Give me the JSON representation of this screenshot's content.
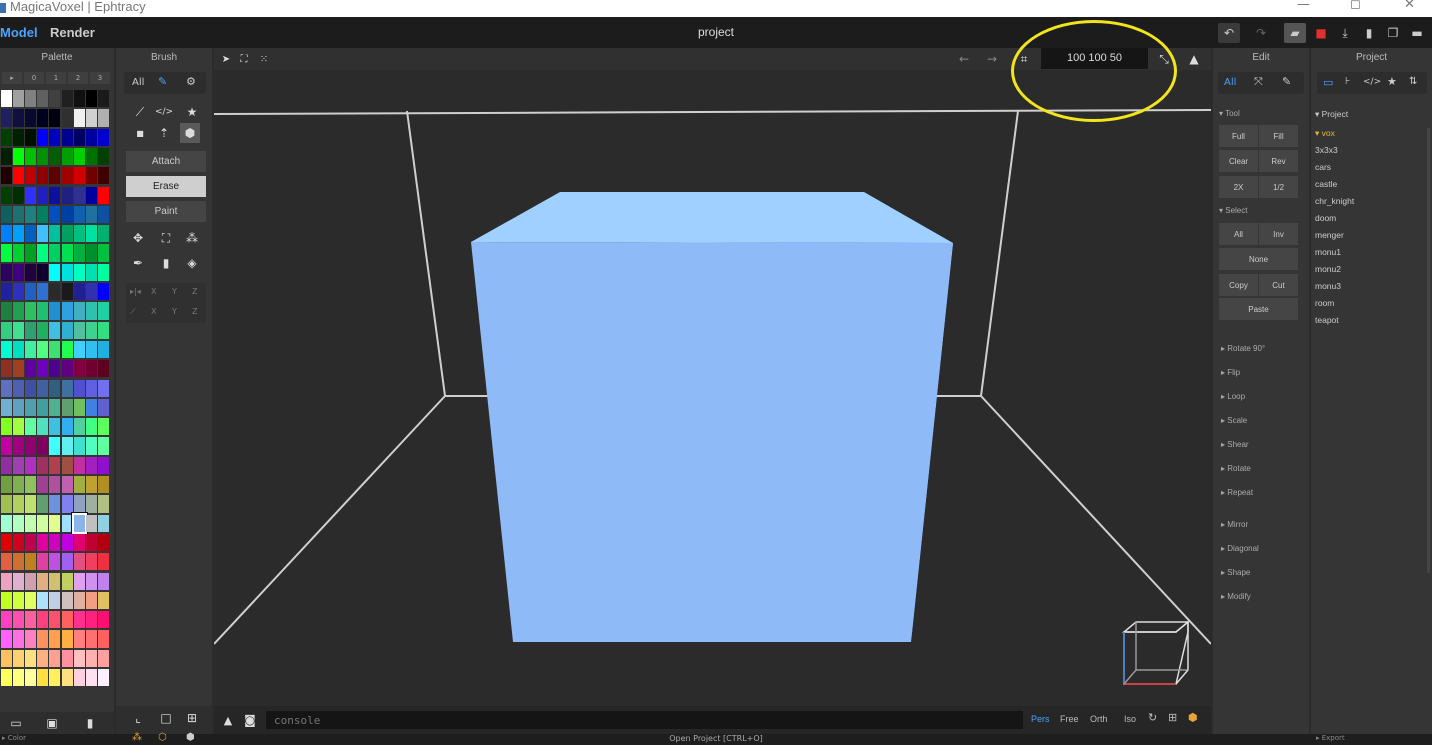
{
  "window": {
    "title": "MagicaVoxel | Ephtracy",
    "min": "—",
    "max": "◻",
    "close": "✕"
  },
  "menu": {
    "model": "Model",
    "render": "Render",
    "project_title": "project"
  },
  "palette": {
    "title": "Palette",
    "tabs": [
      "▸",
      "0",
      "1",
      "2",
      "3"
    ],
    "selected_color": "#8cb4e8",
    "colors": [
      [
        "#ffffff",
        "#a0a0a0",
        "#808080",
        "#606060",
        "#404040",
        "#202020",
        "#101010",
        "#000000",
        "#1a1a1a"
      ],
      [
        "#202060",
        "#101040",
        "#080830",
        "#000020",
        "#000010",
        "#303030",
        "#f0f0f0",
        "#d0d0d0",
        "#b0b0b0"
      ],
      [
        "#004000",
        "#002000",
        "#001000",
        "#0000ff",
        "#0000c0",
        "#000090",
        "#000060",
        "#0000a0",
        "#0000d0"
      ],
      [
        "#002000",
        "#00ff00",
        "#00c000",
        "#009000",
        "#006000",
        "#00a000",
        "#00d000",
        "#007000",
        "#004000"
      ],
      [
        "#200000",
        "#ff0000",
        "#c00000",
        "#900000",
        "#600000",
        "#a00000",
        "#d00000",
        "#700000",
        "#400000"
      ],
      [
        "#004000",
        "#003000",
        "#3030ff",
        "#2020c0",
        "#1010a0",
        "#202080",
        "#303090",
        "#0000a0",
        "#ff0000"
      ],
      [
        "#106060",
        "#207070",
        "#208080",
        "#008060",
        "#0050c0",
        "#0040a0",
        "#1060b0",
        "#2070a0",
        "#1050a0"
      ],
      [
        "#0080ff",
        "#00a0ff",
        "#0060c0",
        "#40c0ff",
        "#00c0a0",
        "#00a060",
        "#00c080",
        "#00e0a0",
        "#00b070"
      ],
      [
        "#00ff40",
        "#00d030",
        "#00a020",
        "#00ff80",
        "#00d060",
        "#00e050",
        "#00b040",
        "#009030",
        "#00c040"
      ],
      [
        "#300060",
        "#400080",
        "#200040",
        "#100030",
        "#00ffff",
        "#00e0e0",
        "#00ffc0",
        "#00e0b0",
        "#00ffa0"
      ],
      [
        "#2020a0",
        "#3030c0",
        "#2060c0",
        "#3070d0",
        "#2a2a2a",
        "#1a1a1a",
        "#202090",
        "#3030b0",
        "#0000ff"
      ],
      [
        "#208040",
        "#20a050",
        "#30c060",
        "#20c070",
        "#2090d0",
        "#30a0e0",
        "#40b0c0",
        "#30c0b0",
        "#20d0a0"
      ],
      [
        "#30d080",
        "#40e090",
        "#30a070",
        "#20b060",
        "#40c0e0",
        "#30b0d0",
        "#50c0a0",
        "#40d090",
        "#30e080"
      ],
      [
        "#00ffd0",
        "#00e0c0",
        "#40f0a0",
        "#50ff80",
        "#40e070",
        "#20ff50",
        "#40d0ff",
        "#30c0f0",
        "#20b0e0"
      ],
      [
        "#903020",
        "#a04020",
        "#6000a0",
        "#7000c0",
        "#500090",
        "#600080",
        "#800040",
        "#700030",
        "#600020"
      ],
      [
        "#6070c0",
        "#5060b0",
        "#4050a0",
        "#4060a0",
        "#306080",
        "#4070a0",
        "#5050d0",
        "#6060e0",
        "#7070f0"
      ],
      [
        "#70b0d0",
        "#60a0c0",
        "#50a0b0",
        "#40a0a0",
        "#50b090",
        "#60a070",
        "#70c060",
        "#4080e0",
        "#6060d0"
      ],
      [
        "#80ff20",
        "#a0ff40",
        "#60ffa0",
        "#50e0c0",
        "#40c0e0",
        "#30b0f0",
        "#50d0a0",
        "#40ff80",
        "#60ff60"
      ],
      [
        "#c000a0",
        "#a00080",
        "#900070",
        "#800060",
        "#40ffff",
        "#60f0f0",
        "#40e0d0",
        "#50ffc0",
        "#60ffa0"
      ],
      [
        "#9030a0",
        "#a040b0",
        "#b030c0",
        "#a03060",
        "#b04050",
        "#a05040",
        "#c030a0",
        "#a020c0",
        "#9010d0"
      ],
      [
        "#70a040",
        "#80b050",
        "#90c060",
        "#a04090",
        "#b050a0",
        "#c060b0",
        "#a0b040",
        "#c0a030",
        "#b09020"
      ],
      [
        "#a0c050",
        "#b0d060",
        "#c0e070",
        "#60a070",
        "#7090e0",
        "#8080f0",
        "#90a0c0",
        "#a0b0a0",
        "#b0c080"
      ],
      [
        "#a0ffd0",
        "#b0ffc0",
        "#c0ffb0",
        "#d0ffa0",
        "#e0ff90",
        "#a0e0ff",
        "#8cb4e8",
        "#c0c0c0",
        "#90d0e0"
      ],
      [
        "#e00000",
        "#d00020",
        "#c00050",
        "#e000a0",
        "#d000c0",
        "#c000e0",
        "#e00070",
        "#c00030",
        "#b00010"
      ],
      [
        "#e06040",
        "#d07030",
        "#c08020",
        "#e040a0",
        "#c050e0",
        "#a060f0",
        "#e05080",
        "#f04060",
        "#f03040"
      ],
      [
        "#f0a0c0",
        "#e0b0d0",
        "#d0a0b0",
        "#e0b080",
        "#d0c070",
        "#c0d060",
        "#e0a0f0",
        "#d090f0",
        "#c080f0"
      ],
      [
        "#c0ff20",
        "#d0ff40",
        "#e0ff60",
        "#b0e0ff",
        "#c0d0e0",
        "#d0c0c0",
        "#e0b0a0",
        "#f0a080",
        "#e0c060"
      ],
      [
        "#ff40c0",
        "#ff50b0",
        "#ff60a0",
        "#ff4080",
        "#ff5070",
        "#ff6060",
        "#ff3090",
        "#ff2080",
        "#ff1070"
      ],
      [
        "#ff60ff",
        "#ff70e0",
        "#ff80c0",
        "#ff9060",
        "#ffa050",
        "#ffb040",
        "#ff8080",
        "#ff7070",
        "#ff6060"
      ],
      [
        "#ffc060",
        "#ffd070",
        "#ffe080",
        "#ffb080",
        "#ffa090",
        "#ff90a0",
        "#ffc0c0",
        "#ffb0b0",
        "#ffa0a0"
      ],
      [
        "#ffff60",
        "#ffff80",
        "#ffffa0",
        "#ffe040",
        "#fff060",
        "#ffe080",
        "#ffd0e0",
        "#ffe0f0",
        "#fff0ff"
      ]
    ]
  },
  "brush": {
    "title": "Brush",
    "all_label": "All",
    "modes": [
      "Attach",
      "Erase",
      "Paint"
    ],
    "axis_row1": [
      "X",
      "Y",
      "Z"
    ],
    "axis_row2": [
      "X",
      "Y",
      "Z"
    ]
  },
  "viewport": {
    "dims": "100  100  50",
    "cube_top": "#9fd0ff",
    "cube_front": "#8fbaf8",
    "cube_side": "#a6c9f6"
  },
  "console": {
    "placeholder": "console",
    "modes": [
      "Pers",
      "Free",
      "Orth",
      "Iso"
    ],
    "active_mode": "Pers"
  },
  "edit": {
    "title": "Edit",
    "all_label": "All",
    "tool_section": "▾ Tool",
    "tool_buttons": [
      [
        "Full",
        "Fill"
      ],
      [
        "Clear",
        "Rev"
      ],
      [
        "2X",
        "1/2"
      ]
    ],
    "select_section": "▾ Select",
    "select_buttons": [
      [
        "All",
        "Inv"
      ]
    ],
    "none_label": "None",
    "copy_label": "Copy",
    "cut_label": "Cut",
    "paste_label": "Paste",
    "collapsed_a": [
      "▸ Rotate 90°",
      "▸ Flip",
      "▸ Loop",
      "▸ Scale",
      "▸ Shear",
      "▸ Rotate",
      "▸ Repeat"
    ],
    "collapsed_b": [
      "▸ Mirror",
      "▸ Diagonal",
      "▸ Shape",
      "▸ Modify"
    ]
  },
  "project": {
    "title": "Project",
    "section": "▾ Project",
    "active": "▾ vox",
    "items": [
      "3x3x3",
      "cars",
      "castle",
      "chr_knight",
      "doom",
      "menger",
      "monu1",
      "monu2",
      "monu3",
      "room",
      "teapot"
    ]
  },
  "status": {
    "color_label": "▸ Color",
    "center": "Open Project [CTRL+O]",
    "export_label": "▸ Export"
  },
  "accent": "#4aa3ff",
  "highlight_color": "#f2e51a"
}
